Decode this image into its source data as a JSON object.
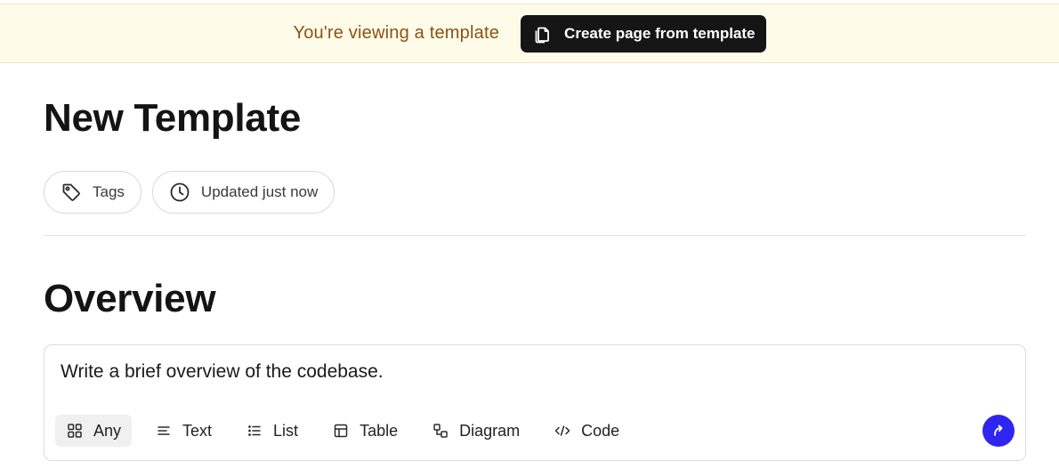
{
  "banner": {
    "message": "You're viewing a template",
    "create_button_label": "Create page from template",
    "create_button_icon": "copy-icon",
    "background_color": "#fefbe8",
    "text_color": "#8a5416"
  },
  "page": {
    "title": "New Template"
  },
  "chips": {
    "tags_label": "Tags",
    "tags_icon": "tag-icon",
    "updated_label": "Updated just now",
    "updated_icon": "clock-icon"
  },
  "section": {
    "title": "Overview",
    "prompt": "Write a brief overview of the codebase."
  },
  "type_options": [
    {
      "label": "Any",
      "icon": "grid-icon",
      "selected": true
    },
    {
      "label": "Text",
      "icon": "text-lines-icon",
      "selected": false
    },
    {
      "label": "List",
      "icon": "list-icon",
      "selected": false
    },
    {
      "label": "Table",
      "icon": "table-icon",
      "selected": false
    },
    {
      "label": "Diagram",
      "icon": "diagram-icon",
      "selected": false
    },
    {
      "label": "Code",
      "icon": "code-icon",
      "selected": false
    }
  ],
  "submit": {
    "icon": "arrow-up-right-icon",
    "color": "#2f25f0"
  }
}
